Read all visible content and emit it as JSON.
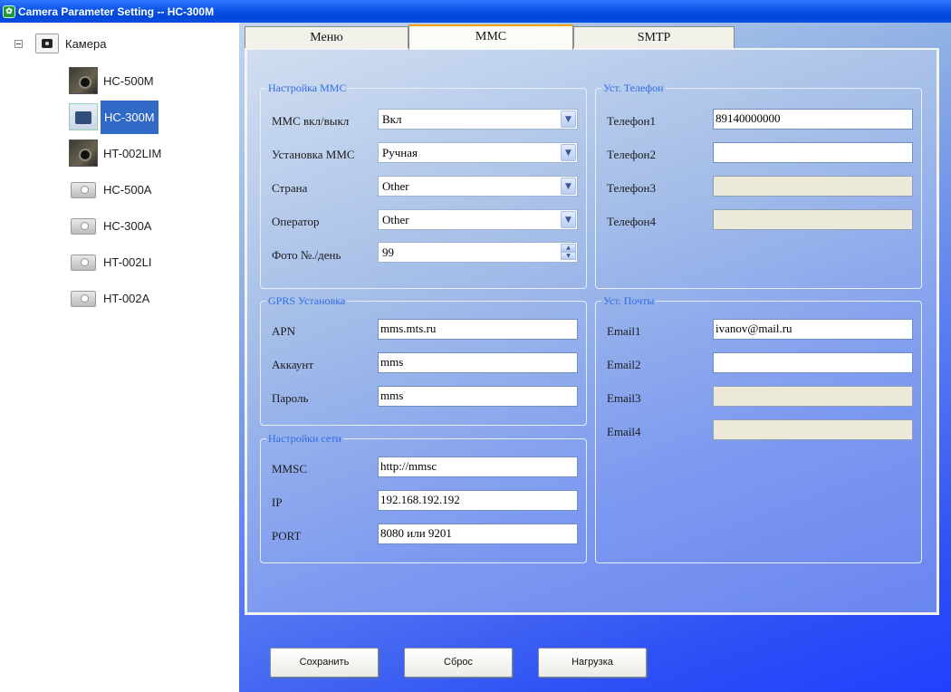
{
  "window": {
    "title": "Camera Parameter Setting -- HC-300M"
  },
  "tree": {
    "root_label": "Камера",
    "items": [
      {
        "label": "HC-500M",
        "icon": "camera-photo",
        "selected": false
      },
      {
        "label": "HC-300M",
        "icon": "camera-photo",
        "selected": true
      },
      {
        "label": "HT-002LIM",
        "icon": "camera-photo",
        "selected": false
      },
      {
        "label": "HC-500A",
        "icon": "camera-gray",
        "selected": false
      },
      {
        "label": "HC-300A",
        "icon": "camera-gray",
        "selected": false
      },
      {
        "label": "HT-002LI",
        "icon": "camera-gray",
        "selected": false
      },
      {
        "label": "HT-002A",
        "icon": "camera-gray",
        "selected": false
      }
    ]
  },
  "tabs": [
    {
      "label": "Меню",
      "active": false
    },
    {
      "label": "MMC",
      "active": true
    },
    {
      "label": "SMTP",
      "active": false
    }
  ],
  "mms_settings": {
    "legend": "Настройка MMC",
    "fields": [
      {
        "label": "MMC вкл/выкл",
        "value": "Вкл"
      },
      {
        "label": "Установка MMC",
        "value": "Ручная"
      },
      {
        "label": "Страна",
        "value": "Other"
      },
      {
        "label": "Оператор",
        "value": "Other"
      },
      {
        "label": "Фото №./день",
        "value": "99"
      }
    ]
  },
  "phone_settings": {
    "legend": "Уст. Телефон",
    "fields": [
      {
        "label": "Телефон1",
        "value": "89140000000"
      },
      {
        "label": "Телефон2",
        "value": ""
      },
      {
        "label": "Телефон3",
        "value": ""
      },
      {
        "label": "Телефон4",
        "value": ""
      }
    ]
  },
  "gprs_settings": {
    "legend": "GPRS Установка",
    "fields": [
      {
        "label": "APN",
        "value": "mms.mts.ru"
      },
      {
        "label": "Аккаунт",
        "value": "mms"
      },
      {
        "label": "Пароль",
        "value": "mms"
      }
    ]
  },
  "network_settings": {
    "legend": "Настройки сети",
    "fields": [
      {
        "label": "MMSC",
        "value": "http://mmsc"
      },
      {
        "label": "IP",
        "value": "192.168.192.192"
      },
      {
        "label": "PORT",
        "value": "8080 или 9201"
      }
    ]
  },
  "email_settings": {
    "legend": "Уст. Почты",
    "fields": [
      {
        "label": "Email1",
        "value": "ivanov@mail.ru"
      },
      {
        "label": "Email2",
        "value": ""
      },
      {
        "label": "Email3",
        "value": ""
      },
      {
        "label": "Email4",
        "value": ""
      }
    ]
  },
  "buttons": {
    "save": "Сохранить",
    "reset": "Сброс",
    "load": "Нагрузка"
  },
  "colors": {
    "legend_text": "#2f6de0",
    "tree_selection": "#3169c6",
    "active_tab_accent": "#f0a30a",
    "disabled_field": "#ece9d8"
  }
}
